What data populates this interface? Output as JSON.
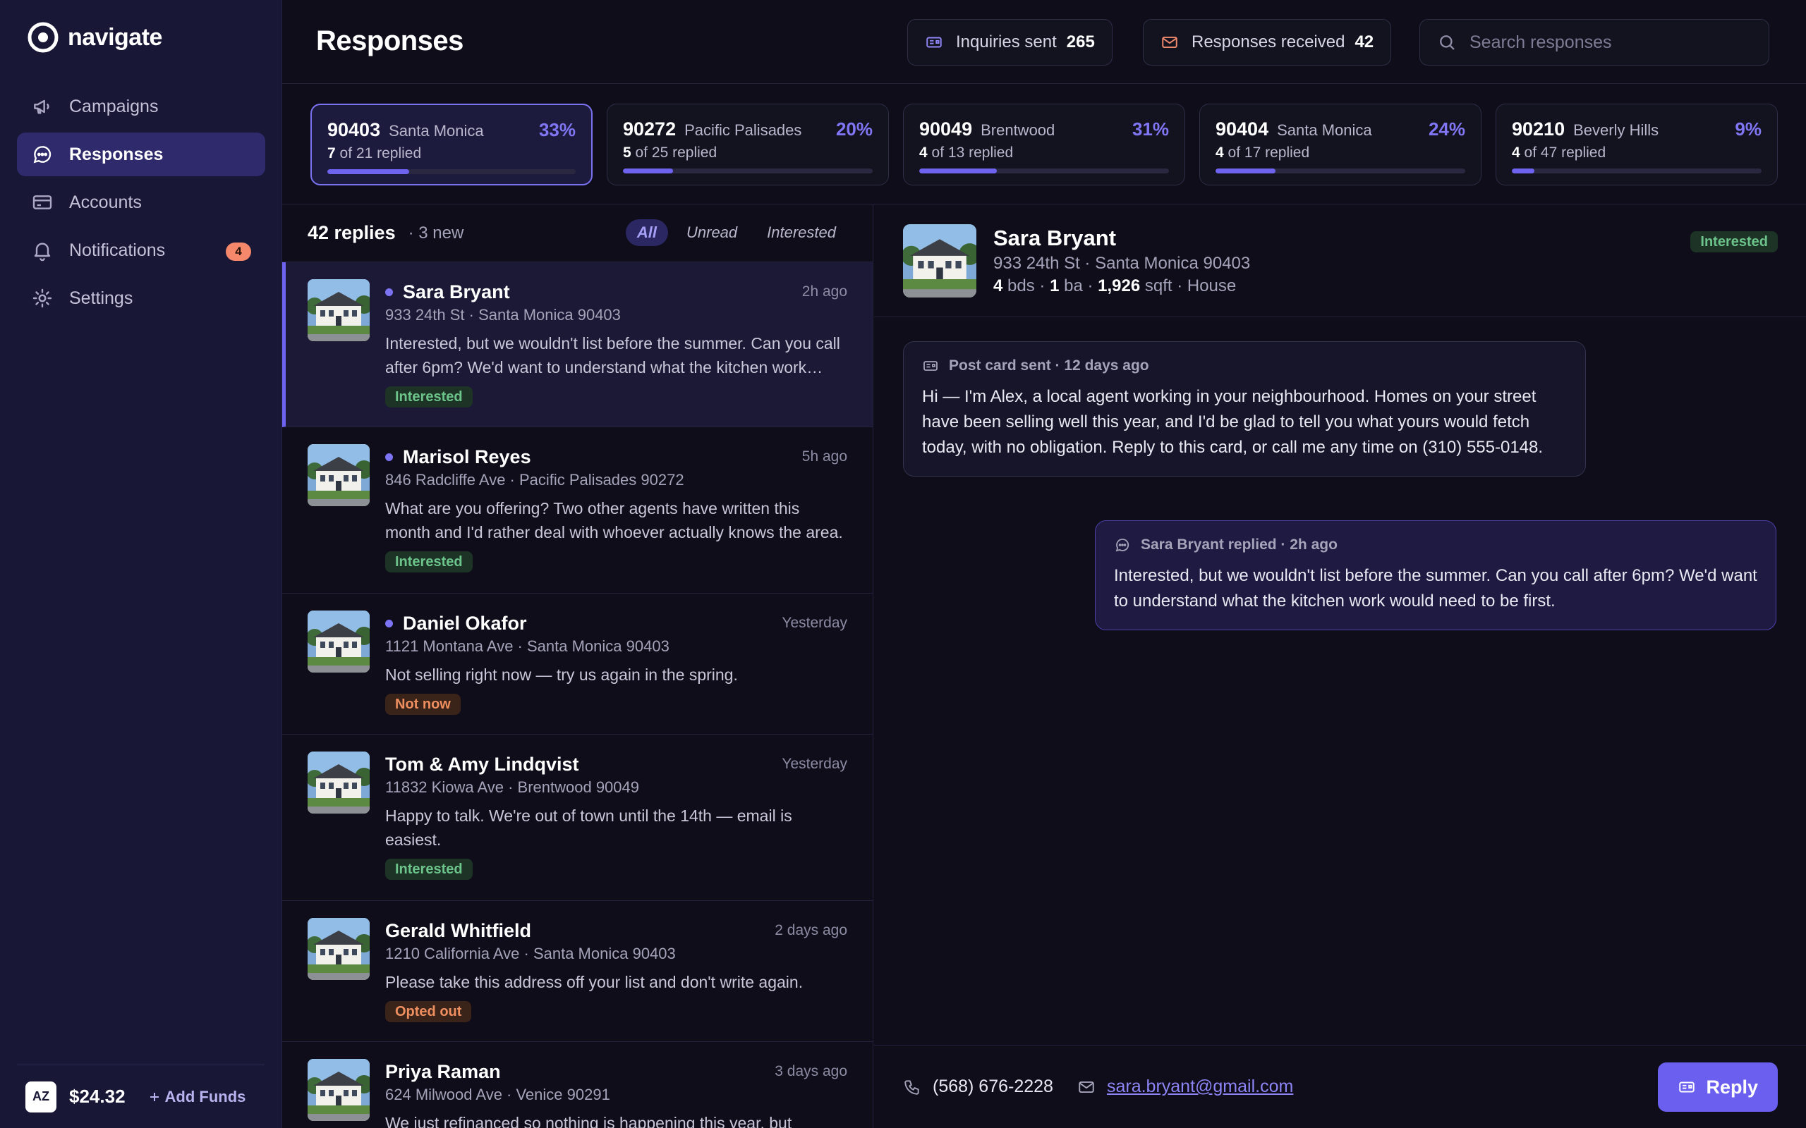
{
  "app": {
    "name": "navigate"
  },
  "sidebar": {
    "items": [
      {
        "label": "Campaigns",
        "icon": "megaphone-icon"
      },
      {
        "label": "Responses",
        "icon": "chat-icon",
        "active": true
      },
      {
        "label": "Accounts",
        "icon": "credit-card-icon"
      },
      {
        "label": "Notifications",
        "icon": "bell-icon",
        "badge": "4"
      },
      {
        "label": "Settings",
        "icon": "gear-icon"
      }
    ],
    "footer": {
      "avatar_initials": "AZ",
      "balance": "$24.32",
      "add_funds": "Add Funds"
    }
  },
  "header": {
    "title": "Responses",
    "stats": [
      {
        "label": "Inquiries sent",
        "value": "265"
      },
      {
        "label": "Responses received",
        "value": "42"
      }
    ],
    "search": {
      "placeholder": "Search responses"
    }
  },
  "zips": [
    {
      "code": "90403",
      "city": "Santa Monica",
      "pct": "33%",
      "replied": "7",
      "total": "21",
      "rate": 0.33
    },
    {
      "code": "90272",
      "city": "Pacific Palisades",
      "pct": "20%",
      "replied": "5",
      "total": "25",
      "rate": 0.2
    },
    {
      "code": "90049",
      "city": "Brentwood",
      "pct": "31%",
      "replied": "4",
      "total": "13",
      "rate": 0.31
    },
    {
      "code": "90404",
      "city": "Santa Monica",
      "pct": "24%",
      "replied": "4",
      "total": "17",
      "rate": 0.24
    },
    {
      "code": "90210",
      "city": "Beverly Hills",
      "pct": "9%",
      "replied": "4",
      "total": "47",
      "rate": 0.09
    }
  ],
  "zip_labels": {
    "of": "of",
    "replied": "replied"
  },
  "list": {
    "count": "42 replies",
    "new": "· 3 new",
    "filters": [
      "All",
      "Unread",
      "Interested"
    ],
    "rows": [
      {
        "name": "Sara Bryant",
        "time": "2h ago",
        "address": "933 24th St · Santa Monica 90403",
        "message": "Interested, but we wouldn't list before the summer. Can you call after 6pm? We'd want to understand what the kitchen work would need to be first.",
        "tag": "Interested"
      },
      {
        "name": "Marisol Reyes",
        "time": "5h ago",
        "address": "846 Radcliffe Ave · Pacific Palisades 90272",
        "message": "What are you offering? Two other agents have written this month and I'd rather deal with whoever actually knows the area.",
        "tag": "Interested"
      },
      {
        "name": "Daniel Okafor",
        "time": "Yesterday",
        "address": "1121 Montana Ave · Santa Monica 90403",
        "message": "Not selling right now — try us again in the spring.",
        "tag": "Not now"
      },
      {
        "name": "Tom & Amy Lindqvist",
        "time": "Yesterday",
        "address": "11832 Kiowa Ave · Brentwood 90049",
        "message": "Happy to talk. We're out of town until the 14th — email is easiest.",
        "tag": "Interested"
      },
      {
        "name": "Gerald Whitfield",
        "time": "2 days ago",
        "address": "1210 California Ave · Santa Monica 90403",
        "message": "Please take this address off your list and don't write again.",
        "tag": "Opted out"
      },
      {
        "name": "Priya Raman",
        "time": "3 days ago",
        "address": "624 Milwood Ave · Venice 90291",
        "message": "We just refinanced so nothing is happening this year, but"
      }
    ]
  },
  "detail": {
    "name": "Sara Bryant",
    "address": "933 24th St · Santa Monica 90403",
    "beds": "4",
    "beds_unit": "bds",
    "baths": "1",
    "baths_unit": "ba",
    "sqft": "1,926",
    "sqft_unit": "sqft",
    "type": "House",
    "tag": "Interested",
    "sent": {
      "header": "Post card sent · 12 days ago",
      "text": "Hi — I'm Alex, a local agent working in your neighbourhood. Homes on your street have been selling well this year, and I'd be glad to tell you what yours would fetch today, with no obligation. Reply to this card, or call me any time on (310) 555-0148."
    },
    "reply": {
      "header": "Sara Bryant replied · 2h ago",
      "text": "Interested, but we wouldn't list before the summer. Can you call after 6pm? We'd want to understand what the kitchen work would need to be first."
    },
    "phone": "(568) 676-2228",
    "email": "sara.bryant@gmail.com",
    "reply_button": "Reply"
  },
  "colors": {
    "accent": "#6d63ee",
    "sidebar": "#191736",
    "background": "#0e0d19",
    "interested": "#6cc48b",
    "warning": "#ef8f5f"
  }
}
